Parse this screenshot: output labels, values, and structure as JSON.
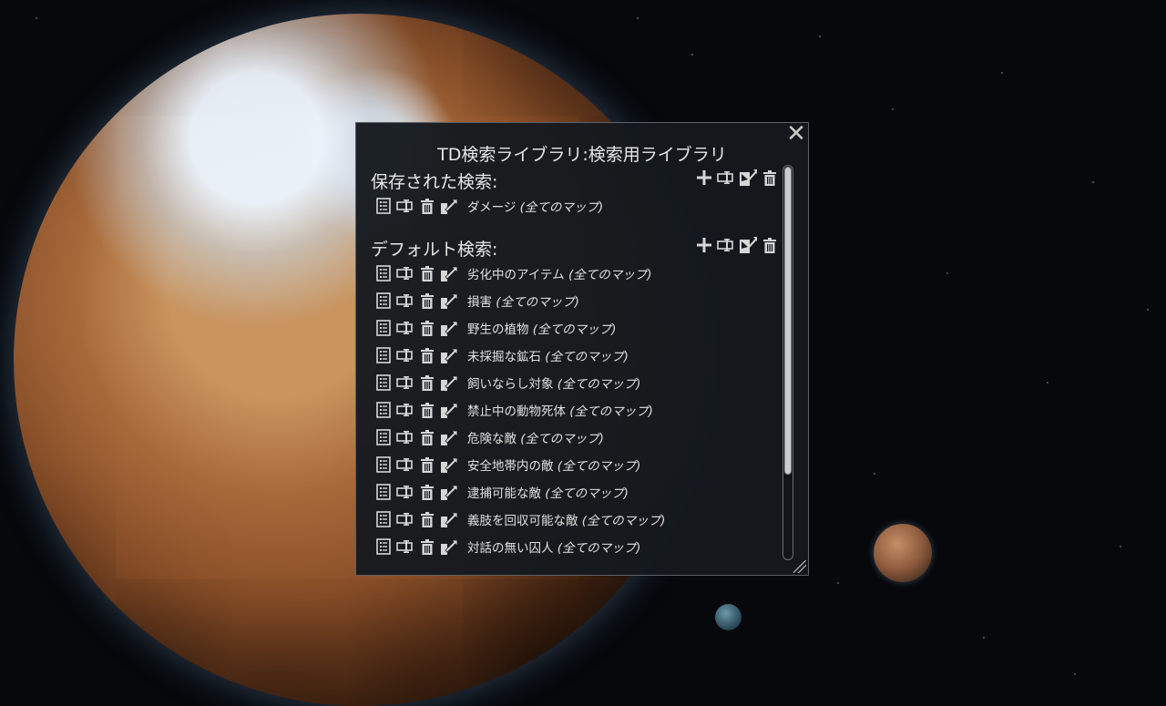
{
  "window": {
    "title": "TD検索ライブラリ:検索用ライブラリ",
    "close_glyph": "✕"
  },
  "saved": {
    "heading": "保存された検索:",
    "items": [
      {
        "name": "ダメージ",
        "scope": "(全てのマップ)"
      }
    ]
  },
  "defaults": {
    "heading": "デフォルト検索:",
    "items": [
      {
        "name": "劣化中のアイテム",
        "scope": "(全てのマップ)"
      },
      {
        "name": "損害",
        "scope": "(全てのマップ)"
      },
      {
        "name": "野生の植物",
        "scope": "(全てのマップ)"
      },
      {
        "name": "未採掘な鉱石",
        "scope": "(全てのマップ)"
      },
      {
        "name": "飼いならし対象",
        "scope": "(全てのマップ)"
      },
      {
        "name": "禁止中の動物死体",
        "scope": "(全てのマップ)"
      },
      {
        "name": "危険な敵",
        "scope": "(全てのマップ)"
      },
      {
        "name": "安全地帯内の敵",
        "scope": "(全てのマップ)"
      },
      {
        "name": "逮捕可能な敵",
        "scope": "(全てのマップ)"
      },
      {
        "name": "義肢を回収可能な敵",
        "scope": "(全てのマップ)"
      },
      {
        "name": "対話の無い囚人",
        "scope": "(全てのマップ)"
      }
    ]
  },
  "icons": {
    "row": [
      "list-icon",
      "rename-icon",
      "trash-icon",
      "export-icon"
    ],
    "section": [
      "plus-icon",
      "rename-icon",
      "import-icon",
      "trash-icon"
    ]
  },
  "colors": {
    "window_bg": "#15191e",
    "border": "#5d6168",
    "text": "#e6e6e6",
    "icon": "#d6d6d6"
  }
}
